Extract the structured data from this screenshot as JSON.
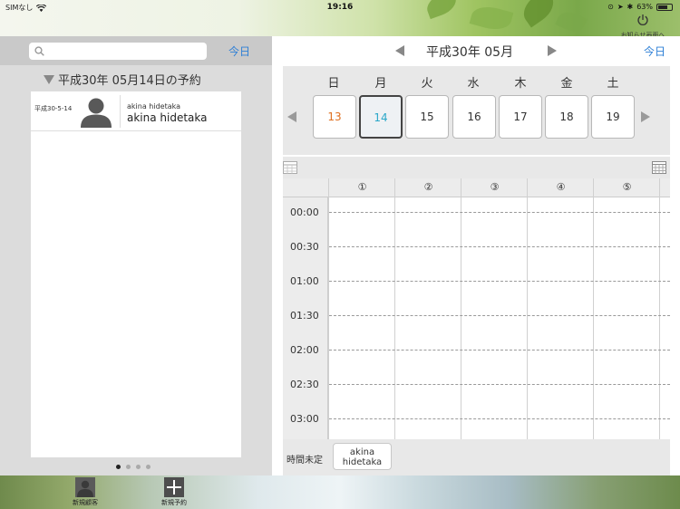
{
  "status_bar": {
    "carrier": "SIMなし",
    "time": "19:16",
    "battery": "63%",
    "notice_button": "お知らせ画面へ"
  },
  "left": {
    "search_placeholder": "",
    "today": "今日",
    "date_heading": "平成30年 05月14日の予約",
    "reservations": [
      {
        "date": "平成30-5-14",
        "small_name": "akina hidetaka",
        "name": "akina hidetaka"
      }
    ],
    "pages": 4,
    "current_page": 1
  },
  "right": {
    "month_title": "平成30年 05月",
    "today": "今日",
    "weekdays": [
      "日",
      "月",
      "火",
      "水",
      "木",
      "金",
      "土"
    ],
    "days": [
      "13",
      "14",
      "15",
      "16",
      "17",
      "18",
      "19"
    ],
    "selected_day": "14",
    "columns": [
      "①",
      "②",
      "③",
      "④",
      "⑤"
    ],
    "times": [
      "00:00",
      "00:30",
      "01:00",
      "01:30",
      "02:00",
      "02:30",
      "03:00"
    ],
    "unscheduled_label": "時間未定",
    "unscheduled_chip": "akina\nhidetaka"
  },
  "toolbar": {
    "new_customer": "新規顧客",
    "new_reservation": "新規予約"
  },
  "colors": {
    "accent": "#2d7fd6",
    "today_day": "#2aa7c9",
    "sunday": "#e07020"
  }
}
